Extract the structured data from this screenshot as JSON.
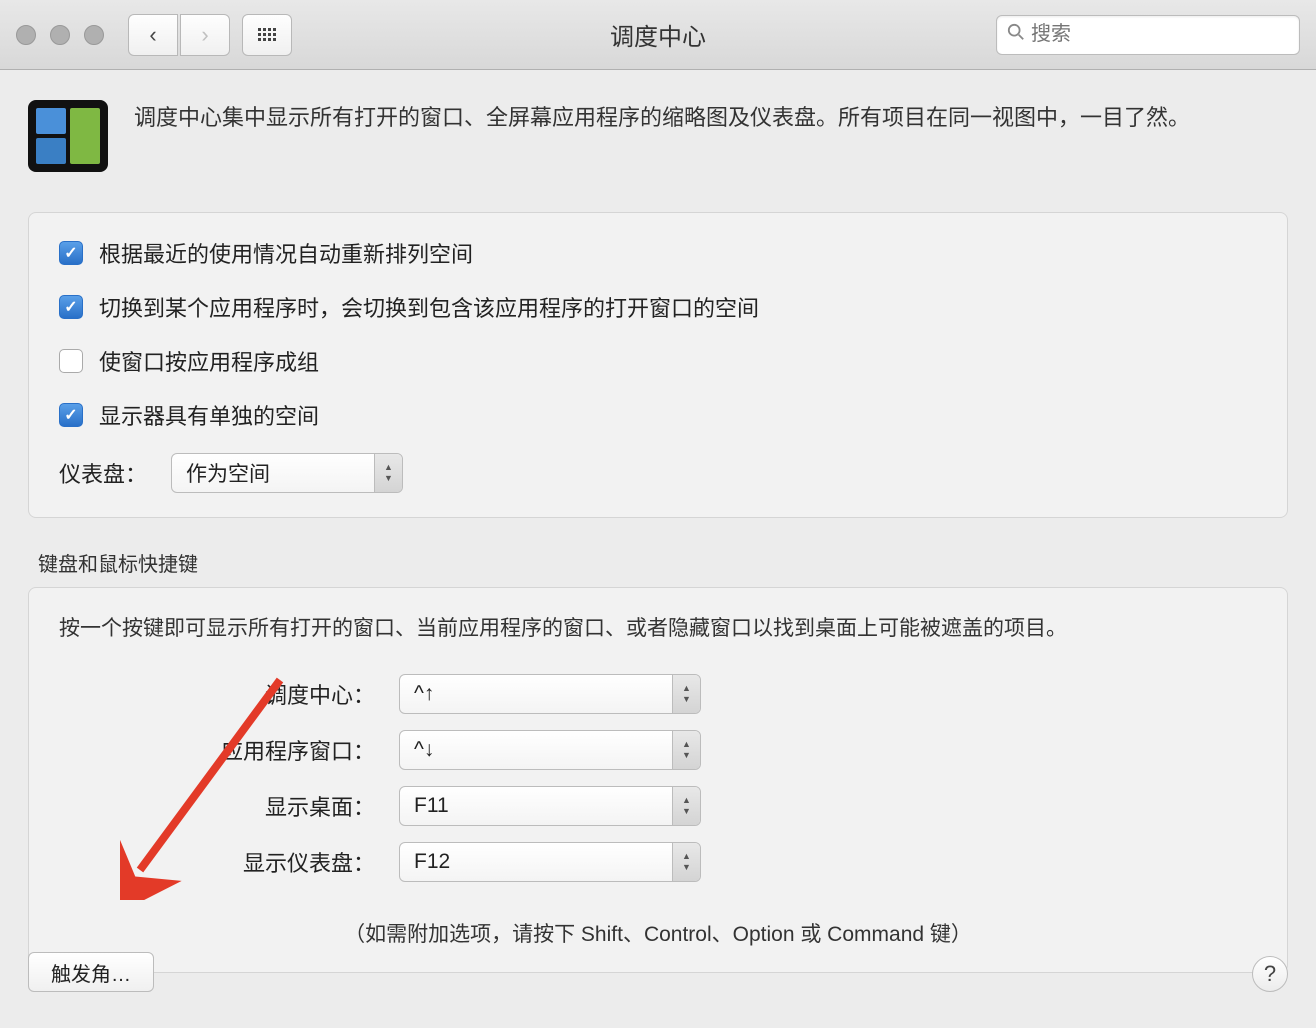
{
  "toolbar": {
    "title": "调度中心",
    "search_placeholder": "搜索"
  },
  "description": "调度中心集中显示所有打开的窗口、全屏幕应用程序的缩略图及仪表盘。所有项目在同一视图中，一目了然。",
  "checkboxes": [
    {
      "label": "根据最近的使用情况自动重新排列空间",
      "checked": true
    },
    {
      "label": "切换到某个应用程序时，会切换到包含该应用程序的打开窗口的空间",
      "checked": true
    },
    {
      "label": "使窗口按应用程序成组",
      "checked": false
    },
    {
      "label": "显示器具有单独的空间",
      "checked": true
    }
  ],
  "dashboard": {
    "label": "仪表盘：",
    "value": "作为空间"
  },
  "shortcuts_section": {
    "title": "键盘和鼠标快捷键",
    "description": "按一个按键即可显示所有打开的窗口、当前应用程序的窗口、或者隐藏窗口以找到桌面上可能被遮盖的项目。",
    "rows": [
      {
        "label": "调度中心：",
        "value": "^↑"
      },
      {
        "label": "应用程序窗口：",
        "value": "^↓"
      },
      {
        "label": "显示桌面：",
        "value": "F11"
      },
      {
        "label": "显示仪表盘：",
        "value": "F12"
      }
    ],
    "hint": "（如需附加选项，请按下 Shift、Control、Option 或 Command 键）"
  },
  "hot_corners_button": "触发角…",
  "help_button": "?"
}
